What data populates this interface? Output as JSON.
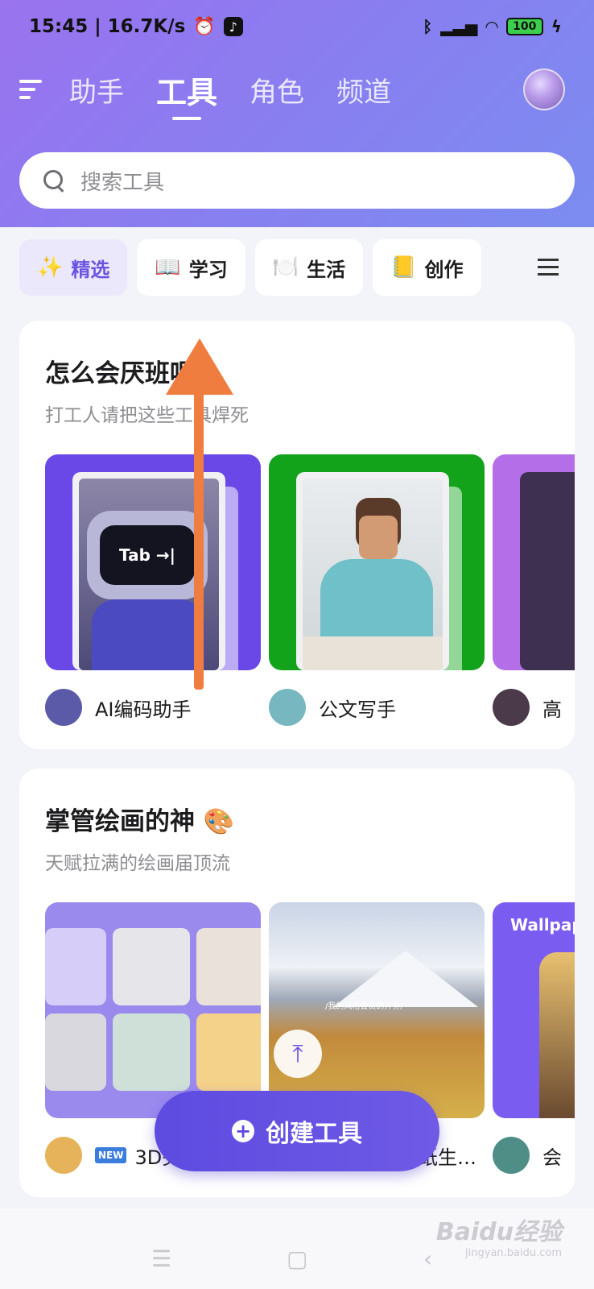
{
  "status": {
    "time": "15:45 | 16.7K/s",
    "battery": "100"
  },
  "nav": {
    "tabs": [
      "助手",
      "工具",
      "角色",
      "频道"
    ],
    "active": "工具"
  },
  "search": {
    "placeholder": "搜索工具"
  },
  "categories": [
    {
      "icon": "✨",
      "label": "精选"
    },
    {
      "icon": "📖",
      "label": "学习"
    },
    {
      "icon": "🍽️",
      "label": "生活"
    },
    {
      "icon": "📒",
      "label": "创作"
    }
  ],
  "sections": [
    {
      "title": "怎么会厌班呢",
      "subtitle": "打工人请把这些工具焊死",
      "tools": [
        {
          "name": "AI编码助手",
          "color": "#6a48e8",
          "image_text": "Tab →|"
        },
        {
          "name": "公文写手",
          "color": "#12a31b"
        },
        {
          "name": "高",
          "color": "#b46fe8"
        }
      ]
    },
    {
      "title": "掌管绘画的神 🎨",
      "subtitle": "天赋拉满的绘画届顶流",
      "tools": [
        {
          "name": "3D头",
          "badge": "NEW",
          "color": "#9b8aee"
        },
        {
          "name": "纸生…",
          "color": "#c9d4e6",
          "image_text": "/我的风格会员的开券/"
        },
        {
          "name": "会",
          "color": "#7b5cf0",
          "image_text": "Wallpap"
        }
      ]
    }
  ],
  "actions": {
    "create_label": "创建工具",
    "scroll_top": "⤒"
  },
  "watermark": {
    "brand": "Baidu经验",
    "site": "jingyan.baidu.com"
  }
}
